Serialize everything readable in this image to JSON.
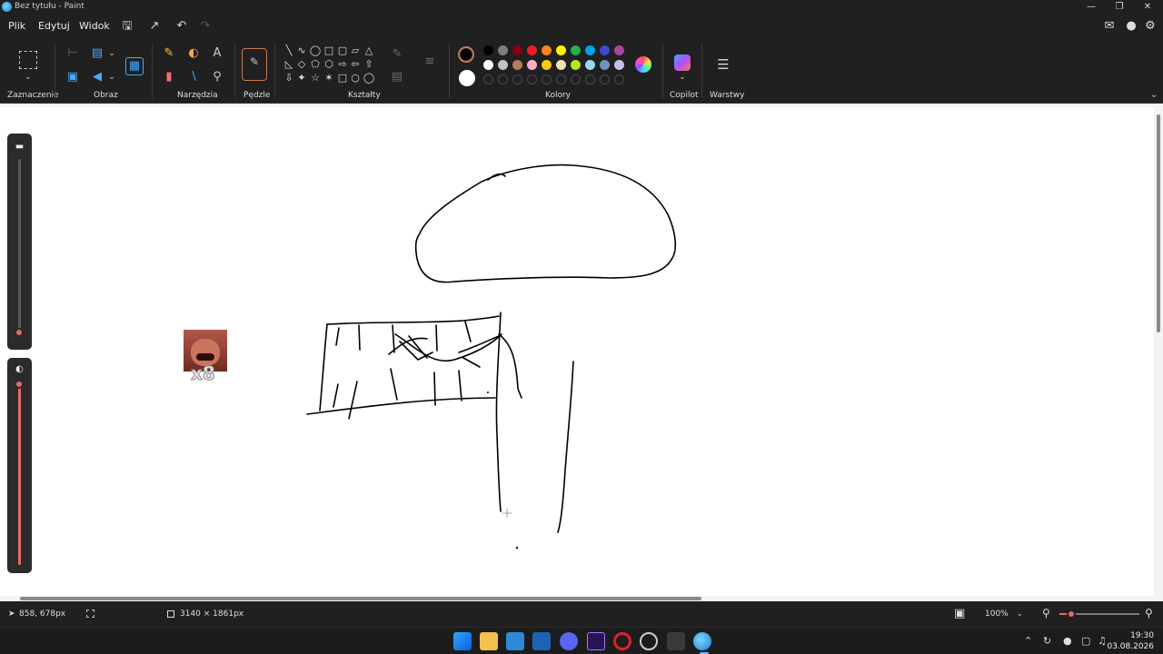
{
  "window": {
    "title": "Bez tytułu - Paint",
    "controls": {
      "minimize": "—",
      "restore": "❐",
      "close": "✕"
    }
  },
  "menu": {
    "items": [
      "Plik",
      "Edytuj",
      "Widok"
    ]
  },
  "ribbon": {
    "groups": {
      "selection": "Zaznaczenie",
      "image": "Obraz",
      "tools": "Narzędzia",
      "brushes": "Pędzle",
      "shapes": "Kształty",
      "colors": "Kolory",
      "copilot": "Copilot",
      "layers": "Warstwy"
    },
    "tools": {
      "text_icon": "A"
    },
    "colors": {
      "primary": "#000000",
      "secondary": "#ffffff",
      "palette_row1": [
        "#000000",
        "#7f7f7f",
        "#880015",
        "#ed1c24",
        "#ff7f27",
        "#fff200",
        "#22b14c",
        "#00a2e8",
        "#3f48cc",
        "#a349a4"
      ],
      "palette_row2": [
        "#ffffff",
        "#c3c3c3",
        "#b97a57",
        "#ffaec9",
        "#ffc90e",
        "#efe4b0",
        "#b5e61d",
        "#99d9ea",
        "#7092be",
        "#c8bfe7"
      ]
    }
  },
  "canvas": {
    "sticker_text": "x8"
  },
  "status": {
    "cursor_pos": "858, 678px",
    "canvas_size": "3140 × 1861px",
    "zoom": "100%",
    "zoom_level": 0.15
  },
  "taskbar": {
    "time": "19:30",
    "date": "03.08.2026"
  }
}
